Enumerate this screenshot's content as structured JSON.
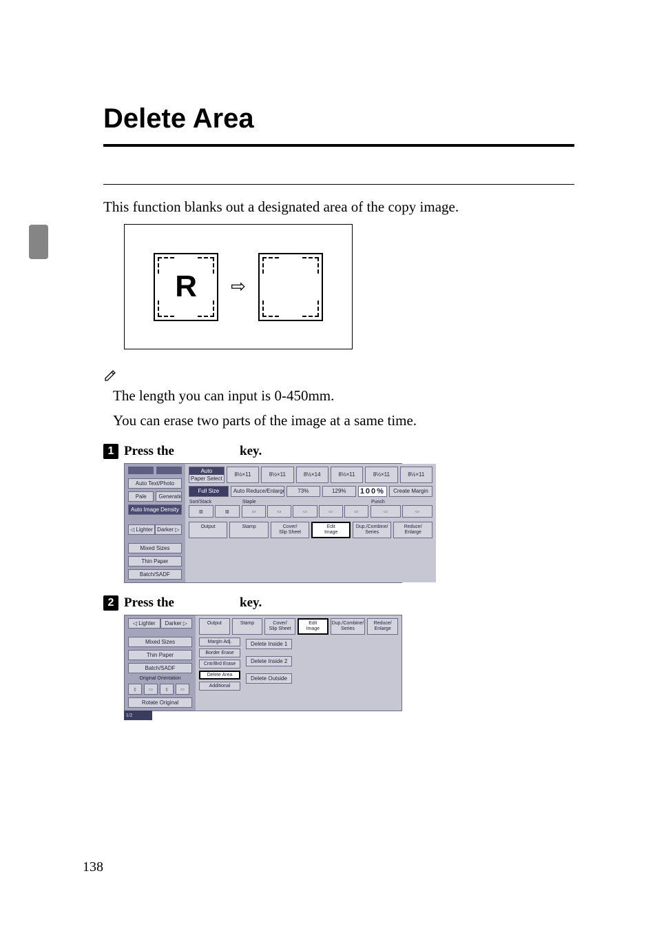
{
  "title": "Delete Area",
  "intro": "This function blanks out a designated area of the copy image.",
  "diagram": {
    "letter": "R",
    "arrow": "⇨"
  },
  "notes": [
    "The length you can input is 0-450mm.",
    "You can erase two parts of the image at a same time."
  ],
  "steps": {
    "s1": {
      "num": "1",
      "prefix": "Press the",
      "suffix": "key."
    },
    "s2": {
      "num": "2",
      "prefix": "Press the",
      "suffix": "key."
    }
  },
  "ui1": {
    "left": {
      "autoTextPhoto": "Auto Text/Photo",
      "pale": "Pale",
      "generation": "Generation",
      "autoImageDensity": "Auto Image Density",
      "lighter": "◁ Lighter",
      "darker": "Darker ▷",
      "mixedSizes": "Mixed Sizes",
      "thinPaper": "Thin Paper",
      "batchSadf": "Batch/SADF"
    },
    "paper": {
      "auto": "Auto",
      "paperSelect": "Paper Select",
      "slots": [
        "8½×11",
        "8½×11",
        "8½×14",
        "8½×11",
        "8½×11",
        "8½×11"
      ]
    },
    "sizeRow": {
      "fullSize": "Full Size",
      "autoReduceEnlarge": "Auto Reduce/Enlarge",
      "p1": "73%",
      "p2": "129%",
      "big": "100%",
      "createMargin": "Create Margin"
    },
    "groups": {
      "sortStack": "Sort/Stack",
      "staple": "Staple",
      "punch": "Punch"
    },
    "tabs": {
      "output": "Output",
      "stamp": "Stamp",
      "coverSlip": "Cover/\nSlip Sheet",
      "editImage": "Edit\nImage",
      "dupCombine": "Dup./Combine/\nSeries",
      "reduceEnlarge": "Reduce/\nEnlarge"
    }
  },
  "ui2": {
    "left": {
      "lighter": "◁ Lighter",
      "darker": "Darker ▷",
      "mixedSizes": "Mixed Sizes",
      "thinPaper": "Thin Paper",
      "batchSadf": "Batch/SADF",
      "originalOrientation": "Original Orientation",
      "rotateOriginal": "Rotate Original"
    },
    "tabs": {
      "output": "Output",
      "stamp": "Stamp",
      "coverSlip": "Cover/\nSlip Sheet",
      "editImage": "Edit\nImage",
      "dupCombine": "Dup./Combine/\nSeries",
      "reduceEnlarge": "Reduce/\nEnlarge"
    },
    "editCol": {
      "marginAdj": "Margin Adj.",
      "borderErase": "Border Erase",
      "centreErase": "Cntr/Brd Erase",
      "deleteArea": "Delete Area",
      "additional": "Additional"
    },
    "actions": {
      "deleteInside1": "Delete Inside 1",
      "deleteInside2": "Delete Inside 2",
      "deleteOutside": "Delete Outside"
    },
    "pageIndicator": "1/2"
  },
  "pageNumber": "138"
}
